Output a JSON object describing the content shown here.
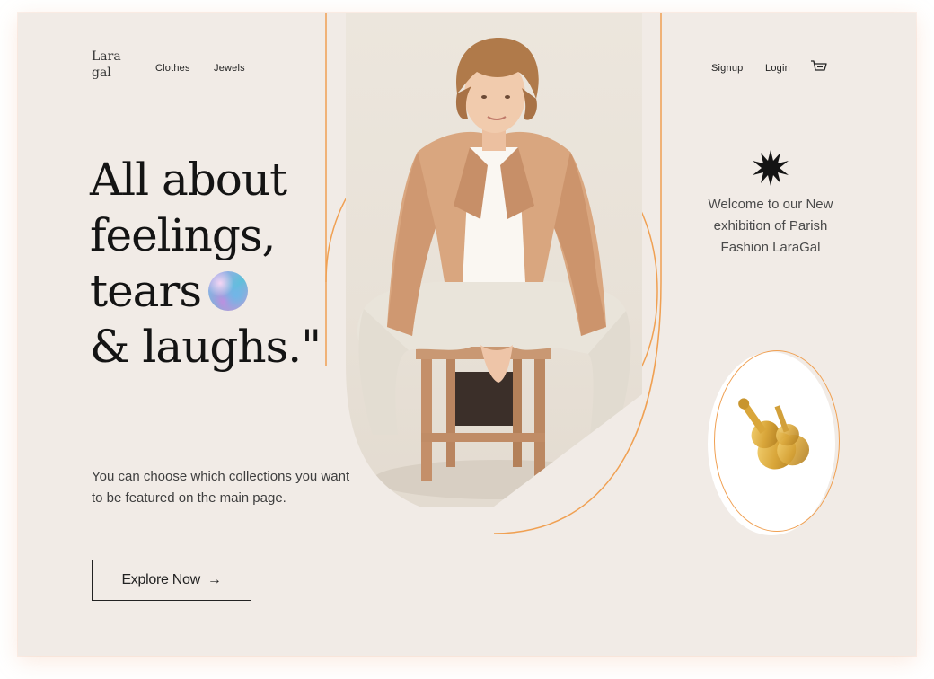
{
  "brand": {
    "logo_line1": "Lara",
    "logo_line2": "gal"
  },
  "nav": {
    "left_links": [
      "Clothes",
      "Jewels"
    ],
    "right_links": [
      "Signup",
      "Login"
    ]
  },
  "hero": {
    "headline": [
      "All about",
      "feelings,",
      "tears",
      "& laughs.\""
    ],
    "subtitle": "You can choose which collections you want to be featured on the main page.",
    "cta_label": "Explore Now",
    "cta_arrow": "→"
  },
  "aside": {
    "welcome": "Welcome to our New exhibition of Parish Fashion LaraGal"
  },
  "icons": {
    "cart": "cart-icon",
    "star": "starburst-icon",
    "orb": "marble-orb-icon",
    "brooch": "violin-brooch-icon"
  },
  "colors": {
    "background": "#f1ebe6",
    "accent_line": "#f0a052",
    "text": "#141414",
    "jacket": "#d9a67f"
  }
}
